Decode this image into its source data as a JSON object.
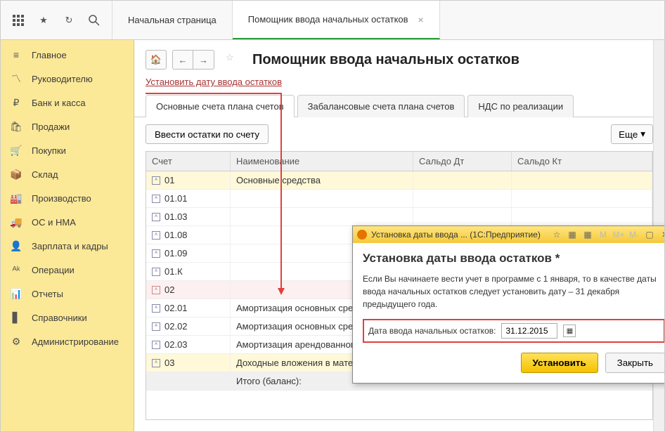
{
  "topbar": {
    "tabs": [
      {
        "label": "Начальная страница"
      },
      {
        "label": "Помощник ввода начальных остатков"
      }
    ]
  },
  "sidebar": {
    "items": [
      {
        "label": "Главное"
      },
      {
        "label": "Руководителю"
      },
      {
        "label": "Банк и касса"
      },
      {
        "label": "Продажи"
      },
      {
        "label": "Покупки"
      },
      {
        "label": "Склад"
      },
      {
        "label": "Производство"
      },
      {
        "label": "ОС и НМА"
      },
      {
        "label": "Зарплата и кадры"
      },
      {
        "label": "Операции"
      },
      {
        "label": "Отчеты"
      },
      {
        "label": "Справочники"
      },
      {
        "label": "Администрирование"
      }
    ]
  },
  "page": {
    "title": "Помощник ввода начальных остатков",
    "set_date_link": "Установить дату ввода остатков"
  },
  "tabs": {
    "main": "Основные счета плана счетов",
    "offbal": "Забалансовые счета плана счетов",
    "nds": "НДС по реализации"
  },
  "toolbar": {
    "enter_btn": "Ввести остатки по счету",
    "more_btn": "Еще"
  },
  "table": {
    "headers": {
      "acc": "Счет",
      "name": "Наименование",
      "dt": "Сальдо Дт",
      "kt": "Сальдо Кт"
    },
    "rows": [
      {
        "acc": "01",
        "name": "Основные средства",
        "grp": 1
      },
      {
        "acc": "01.01",
        "name": ""
      },
      {
        "acc": "01.03",
        "name": ""
      },
      {
        "acc": "01.08",
        "name": ""
      },
      {
        "acc": "01.09",
        "name": ""
      },
      {
        "acc": "01.К",
        "name": ""
      },
      {
        "acc": "02",
        "name": "",
        "grp": 2
      },
      {
        "acc": "02.01",
        "name": "Амортизация основных средств, ..."
      },
      {
        "acc": "02.02",
        "name": "Амортизация основных средств, ..."
      },
      {
        "acc": "02.03",
        "name": "Амортизация арендованного иму..."
      },
      {
        "acc": "03",
        "name": "Доходные вложения в материаль...",
        "grp": 1
      }
    ],
    "total_label": "Итого (баланс):"
  },
  "dialog": {
    "window_title": "Установка даты ввода ...  (1С:Предприятие)",
    "heading": "Установка даты ввода остатков *",
    "text": "Если Вы начинаете вести учет в программе с 1 января, то в качестве даты ввода начальных остатков следует установить дату – 31 декабря предыдущего года.",
    "field_label": "Дата ввода начальных остатков:",
    "field_value": "31.12.2015",
    "btn_set": "Установить",
    "btn_close": "Закрыть",
    "title_icons": {
      "star": "☆",
      "calc": "▦",
      "cal": "▦",
      "m": "M",
      "mplus": "M+",
      "mminus": "M-"
    }
  }
}
